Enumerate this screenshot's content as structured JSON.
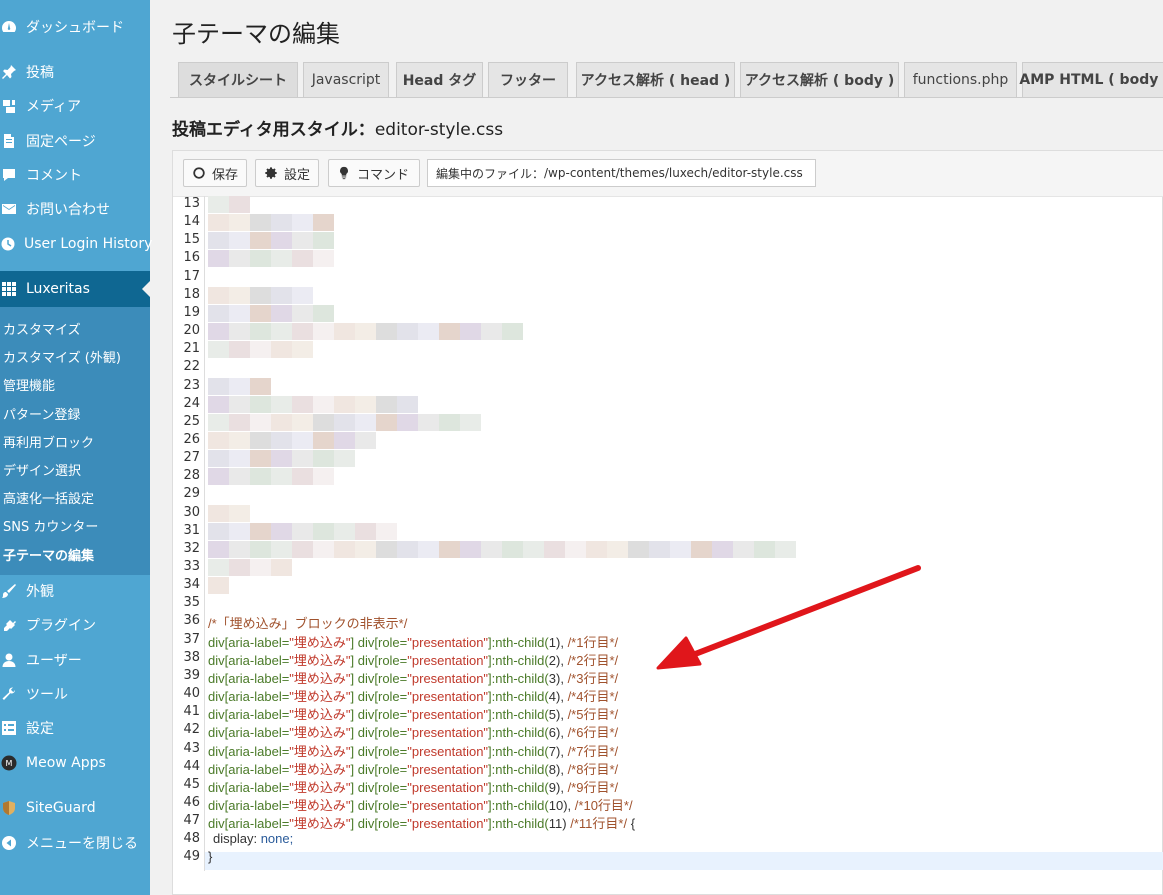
{
  "sidebar": {
    "items": [
      {
        "label": "ダッシュボード",
        "icon": "dashboard-icon"
      },
      {
        "label": "投稿",
        "icon": "pin-icon"
      },
      {
        "label": "メディア",
        "icon": "media-icon"
      },
      {
        "label": "固定ページ",
        "icon": "page-icon"
      },
      {
        "label": "コメント",
        "icon": "comment-icon"
      },
      {
        "label": "お問い合わせ",
        "icon": "mail-icon"
      },
      {
        "label": "User Login History",
        "icon": "clock-icon"
      },
      {
        "label": "Luxeritas",
        "icon": "grid-icon"
      },
      {
        "label": "外観",
        "icon": "brush-icon"
      },
      {
        "label": "プラグイン",
        "icon": "plugin-icon"
      },
      {
        "label": "ユーザー",
        "icon": "user-icon"
      },
      {
        "label": "ツール",
        "icon": "wrench-icon"
      },
      {
        "label": "設定",
        "icon": "settings-icon"
      },
      {
        "label": "Meow Apps",
        "icon": "meow-icon"
      },
      {
        "label": "SiteGuard",
        "icon": "shield-icon"
      },
      {
        "label": "メニューを閉じる",
        "icon": "collapse-icon"
      }
    ],
    "submenu": [
      "カスタマイズ",
      "カスタマイズ (外観)",
      "管理機能",
      "パターン登録",
      "再利用ブロック",
      "デザイン選択",
      "高速化一括設定",
      "SNS カウンター",
      "子テーマの編集"
    ]
  },
  "page": {
    "title": "子テーマの編集",
    "section_label": "投稿エディタ用スタイル：",
    "section_file": "editor-style.css"
  },
  "tabs": [
    "スタイルシート",
    "Javascript",
    "Head タグ",
    "フッター",
    "アクセス解析 ( head )",
    "アクセス解析 ( body )",
    "functions.php",
    "AMP HTML ( body )"
  ],
  "toolbar": {
    "save_label": "保存",
    "settings_label": "設定",
    "command_label": "コマンド",
    "file_label": "編集中のファイル：",
    "file_path": "/wp-content/themes/luxech/editor-style.css"
  },
  "code": {
    "line_numbers": [
      "13",
      "14",
      "15",
      "16",
      "17",
      "18",
      "19",
      "20",
      "21",
      "22",
      "23",
      "24",
      "25",
      "26",
      "27",
      "28",
      "29",
      "30",
      "31",
      "32",
      "33",
      "34",
      "35",
      "36",
      "37",
      "38",
      "39",
      "40",
      "41",
      "42",
      "43",
      "44",
      "45",
      "46",
      "47",
      "48",
      "49"
    ],
    "comment_line": "/*「埋め込み」ブロックの非表示*/",
    "selector_prefix": "div[aria-label=",
    "selector_str": "\"埋め込み\"",
    "selector_mid": "] div[role=",
    "selector_role": "\"presentation\"",
    "selector_nth": "]:nth-child(",
    "rules": [
      {
        "n": "1",
        "sep": "),",
        "comment": "/*1行目*/"
      },
      {
        "n": "2",
        "sep": "),",
        "comment": "/*2行目*/"
      },
      {
        "n": "3",
        "sep": "),",
        "comment": "/*3行目*/"
      },
      {
        "n": "4",
        "sep": "),",
        "comment": "/*4行目*/"
      },
      {
        "n": "5",
        "sep": "),",
        "comment": "/*5行目*/"
      },
      {
        "n": "6",
        "sep": "),",
        "comment": "/*6行目*/"
      },
      {
        "n": "7",
        "sep": "),",
        "comment": "/*7行目*/"
      },
      {
        "n": "8",
        "sep": "),",
        "comment": "/*8行目*/"
      },
      {
        "n": "9",
        "sep": "),",
        "comment": "/*9行目*/"
      },
      {
        "n": "10",
        "sep": "),",
        "comment": "/*10行目*/"
      },
      {
        "n": "11",
        "sep": ")",
        "comment": "/*11行目*/"
      }
    ],
    "brace_open": "{",
    "decl_prop": "display:",
    "decl_val": "none;",
    "brace_close": "}"
  },
  "colors": {
    "sidebar_bg": "#4fa6d2",
    "sidebar_current": "#0f6792",
    "arrow": "#e0161b"
  }
}
